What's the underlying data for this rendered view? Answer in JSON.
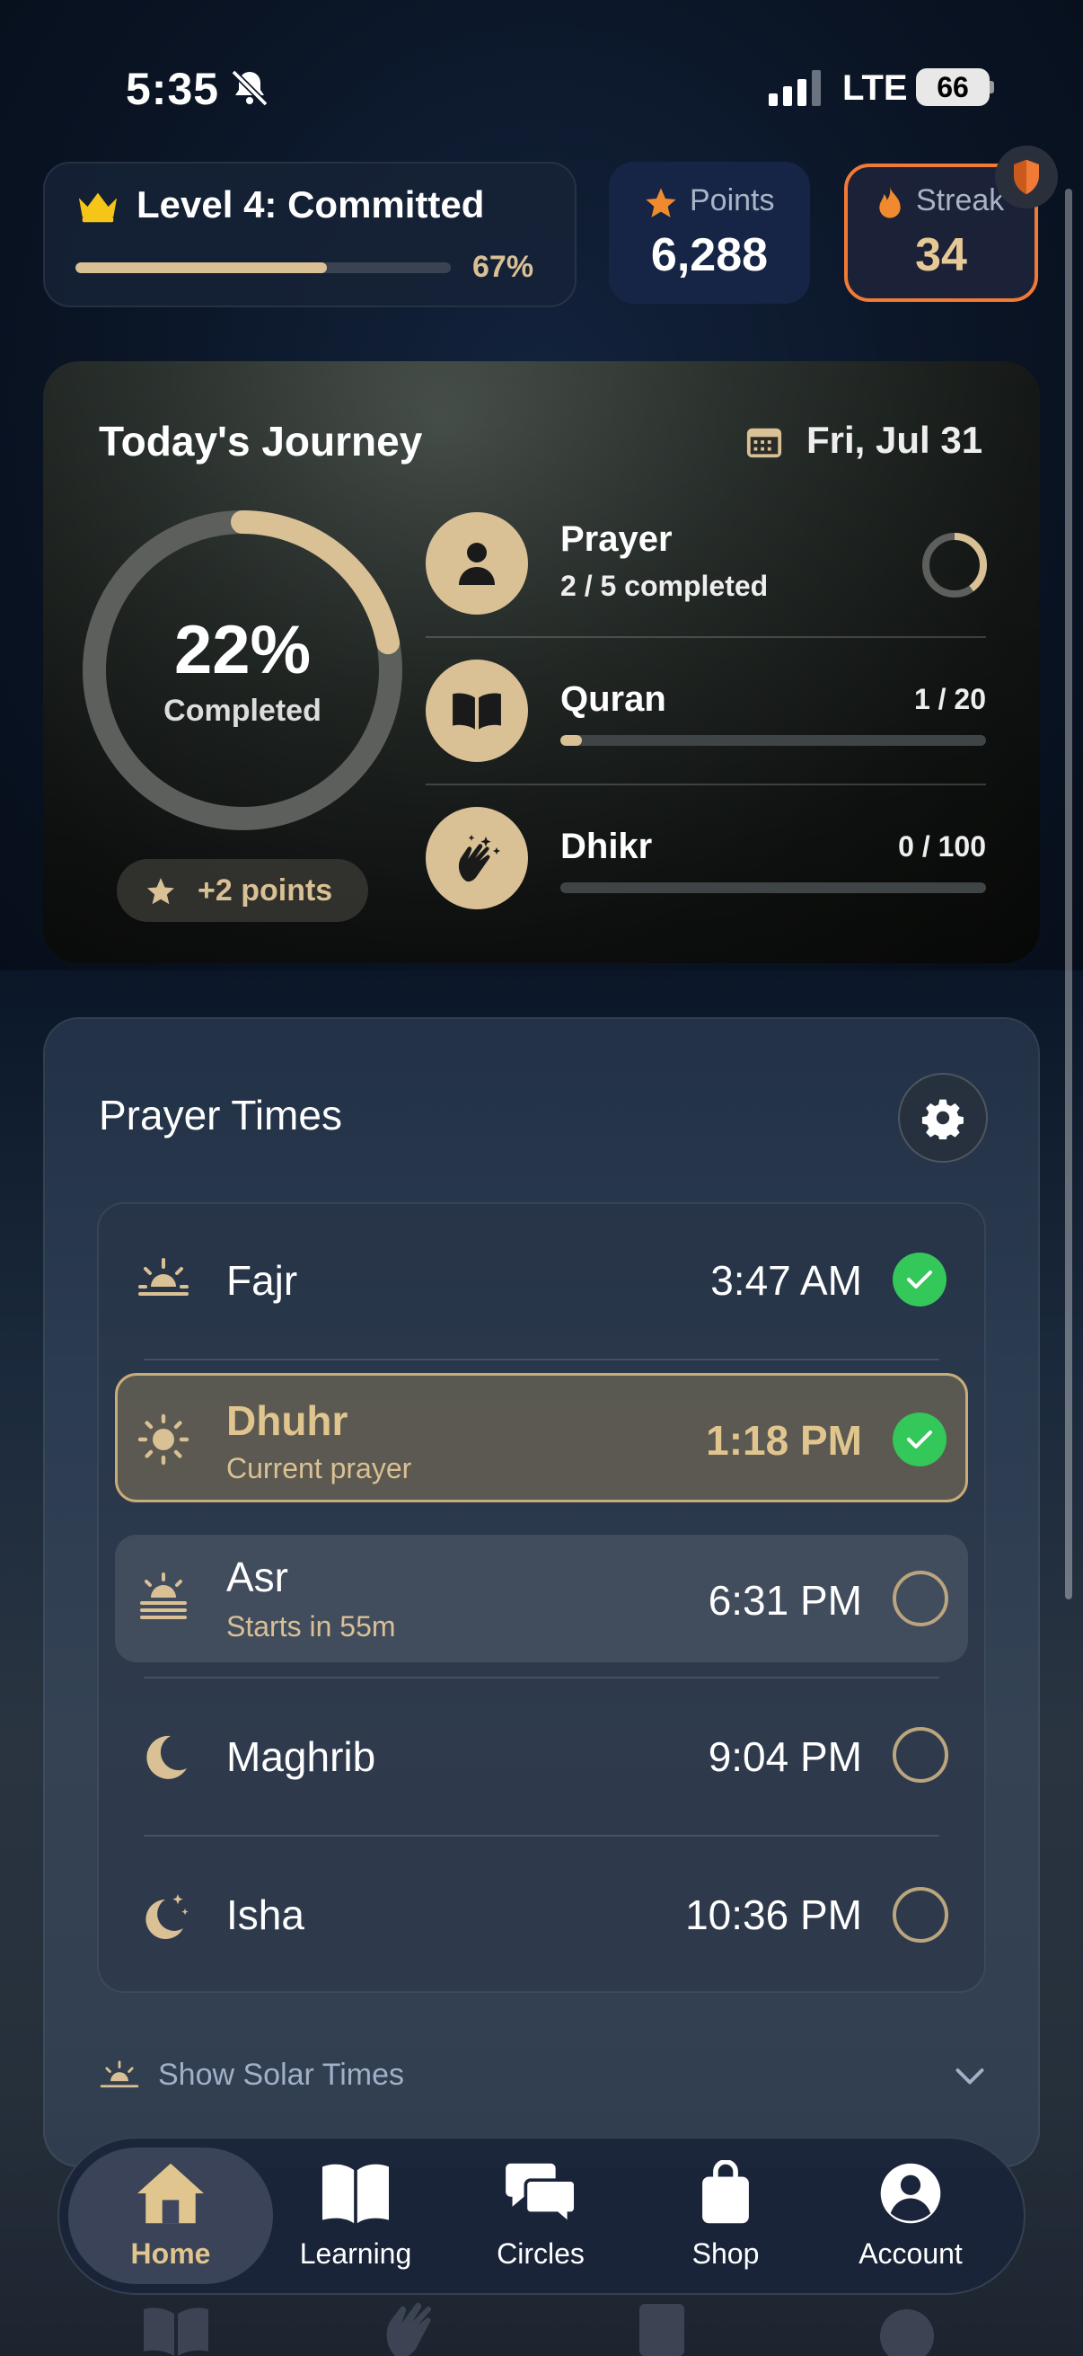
{
  "status_bar": {
    "time": "5:35",
    "network": "LTE",
    "battery": "66"
  },
  "level": {
    "title": "Level 4: Committed",
    "percent_label": "67%",
    "progress": 0.67
  },
  "points": {
    "label": "Points",
    "value": "6,288"
  },
  "streak": {
    "label": "Streak",
    "value": "34"
  },
  "journey": {
    "title": "Today's Journey",
    "date": "Fri, Jul 31",
    "ring_percent": "22%",
    "ring_label": "Completed",
    "ring_progress": 0.22,
    "points_badge": "+2 points",
    "activities": [
      {
        "name": "Prayer",
        "sub": "2 / 5 completed",
        "progress": 0.4
      },
      {
        "name": "Quran",
        "count": "1 / 20",
        "progress": 0.05
      },
      {
        "name": "Dhikr",
        "count": "0 / 100",
        "progress": 0.0
      }
    ]
  },
  "prayer_times": {
    "title": "Prayer Times",
    "prayers": [
      {
        "name": "Fajr",
        "time": "3:47 AM",
        "done": true
      },
      {
        "name": "Dhuhr",
        "sub": "Current prayer",
        "time": "1:18 PM",
        "done": true
      },
      {
        "name": "Asr",
        "sub": "Starts in 55m",
        "time": "6:31 PM",
        "done": false
      },
      {
        "name": "Maghrib",
        "time": "9:04 PM",
        "done": false
      },
      {
        "name": "Isha",
        "time": "10:36 PM",
        "done": false
      }
    ],
    "solar_toggle": "Show Solar Times"
  },
  "nav": {
    "items": [
      {
        "label": "Home",
        "icon": "home-icon",
        "active": true
      },
      {
        "label": "Learning",
        "icon": "book-icon"
      },
      {
        "label": "Circles",
        "icon": "chat-bubbles-icon"
      },
      {
        "label": "Shop",
        "icon": "bag-icon"
      },
      {
        "label": "Account",
        "icon": "person-icon"
      }
    ]
  },
  "colors": {
    "gold": "#d9c095",
    "streak_orange": "#f07a36",
    "check_green": "#34c759",
    "navy": "#0b1526"
  }
}
